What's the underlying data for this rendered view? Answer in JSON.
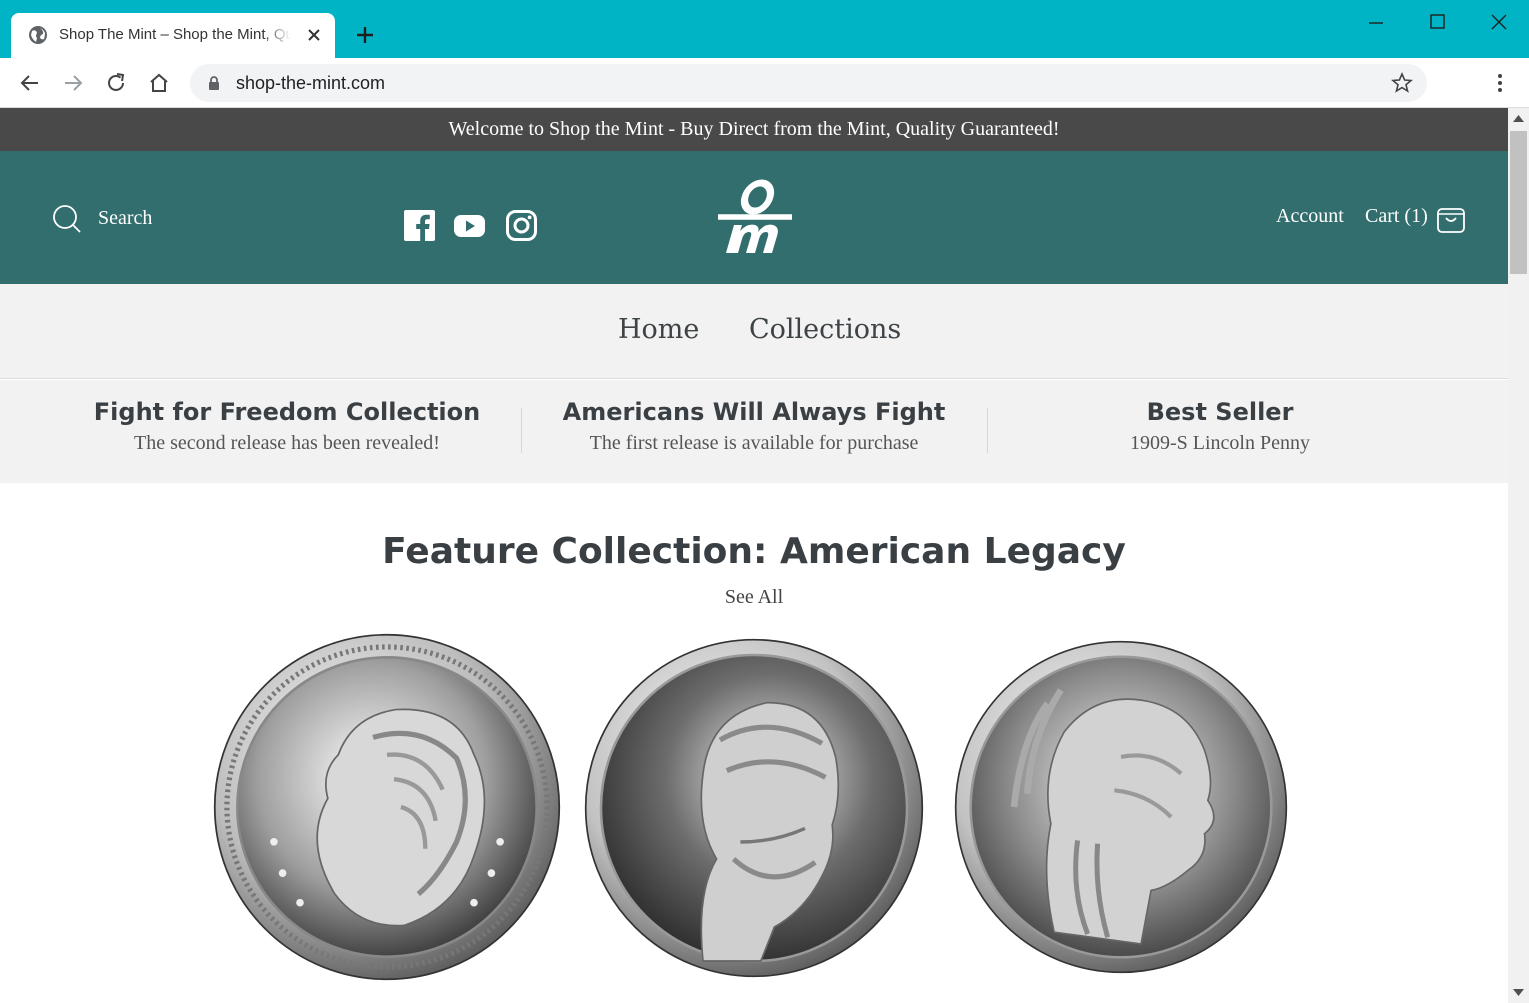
{
  "browser": {
    "tab_title": "Shop The Mint – Shop the Mint, Quality Guaranteed",
    "url": "shop-the-mint.com"
  },
  "site": {
    "announcement": "Welcome to Shop the Mint - Buy Direct from the Mint, Quality Guaranteed!",
    "search_label": "Search",
    "account_label": "Account",
    "cart_label": "Cart (1)",
    "logo_letters": "om",
    "colors": {
      "header": "#336e6f",
      "announcement": "#494949",
      "chrome": "#00b4c5"
    }
  },
  "nav": {
    "home": "Home",
    "collections": "Collections"
  },
  "promos": [
    {
      "title": "Fight for Freedom Collection",
      "subtitle": "The second release has been revealed!"
    },
    {
      "title": "Americans Will Always Fight",
      "subtitle": "The first release is available for purchase"
    },
    {
      "title": "Best Seller",
      "subtitle": "1909-S Lincoln Penny"
    }
  ],
  "feature": {
    "title": "Feature Collection: American Legacy",
    "see_all": "See All"
  },
  "icons": [
    "globe-icon",
    "close-icon",
    "plus-icon",
    "back-icon",
    "forward-icon",
    "reload-icon",
    "home-icon",
    "lock-icon",
    "star-icon",
    "kebab-menu-icon",
    "search-icon",
    "facebook-icon",
    "youtube-icon",
    "instagram-icon",
    "cart-bag-icon"
  ]
}
